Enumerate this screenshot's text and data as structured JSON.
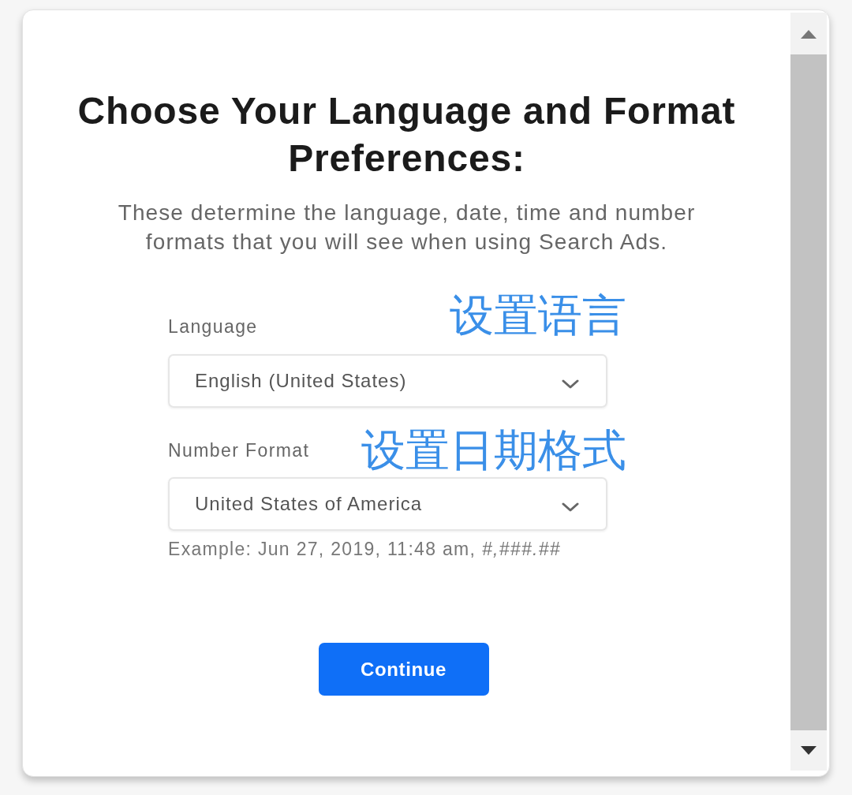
{
  "dialog": {
    "title": "Choose Your Language and Format Preferences:",
    "description": "These determine the language, date, time and number formats that you will see when using Search Ads.",
    "fields": [
      {
        "label": "Language",
        "value": "English (United States)",
        "annotation": "设置语言"
      },
      {
        "label": "Number Format",
        "value": "United States of America",
        "annotation": "设置日期格式",
        "hint": "Example: Jun 27, 2019, 11:48 am, *#,###.##*"
      }
    ],
    "primary_button": "Continue"
  }
}
